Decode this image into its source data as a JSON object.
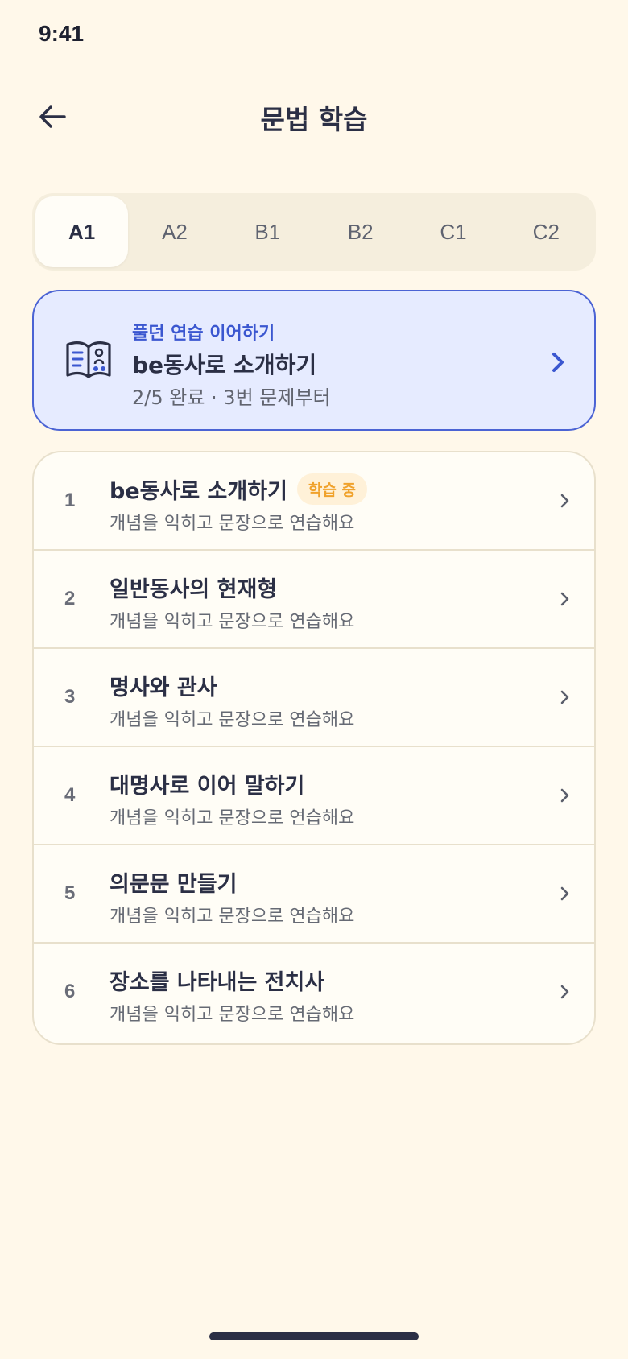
{
  "status_bar": {
    "time": "9:41"
  },
  "header": {
    "title": "문법 학습"
  },
  "levels": {
    "active": "A1",
    "tabs": [
      "A1",
      "A2",
      "B1",
      "B2",
      "C1",
      "C2"
    ]
  },
  "resume": {
    "kicker": "풀던 연습 이어하기",
    "title": "be동사로 소개하기",
    "subtitle": "2/5 완료 · 3번 문제부터"
  },
  "lessons": [
    {
      "number": "1",
      "title": "be동사로 소개하기",
      "badge": "학습 중",
      "desc": "개념을 익히고 문장으로 연습해요"
    },
    {
      "number": "2",
      "title": "일반동사의 현재형",
      "desc": "개념을 익히고 문장으로 연습해요"
    },
    {
      "number": "3",
      "title": "명사와 관사",
      "desc": "개념을 익히고 문장으로 연습해요"
    },
    {
      "number": "4",
      "title": "대명사로 이어 말하기",
      "desc": "개념을 익히고 문장으로 연습해요"
    },
    {
      "number": "5",
      "title": "의문문 만들기",
      "desc": "개념을 익히고 문장으로 연습해요"
    },
    {
      "number": "6",
      "title": "장소를 나타내는 전치사",
      "desc": "개념을 익히고 문장으로 연습해요"
    }
  ],
  "icons": {
    "back": "arrow-left-icon",
    "resume": "book-icon",
    "chevron": "chevron-right-icon"
  },
  "colors": {
    "background": "#FFF8EA",
    "accent": "#3B57D0",
    "resume_bg": "#E6EBFF",
    "badge_text": "#F0A22C",
    "badge_bg": "#FFF1D8"
  }
}
